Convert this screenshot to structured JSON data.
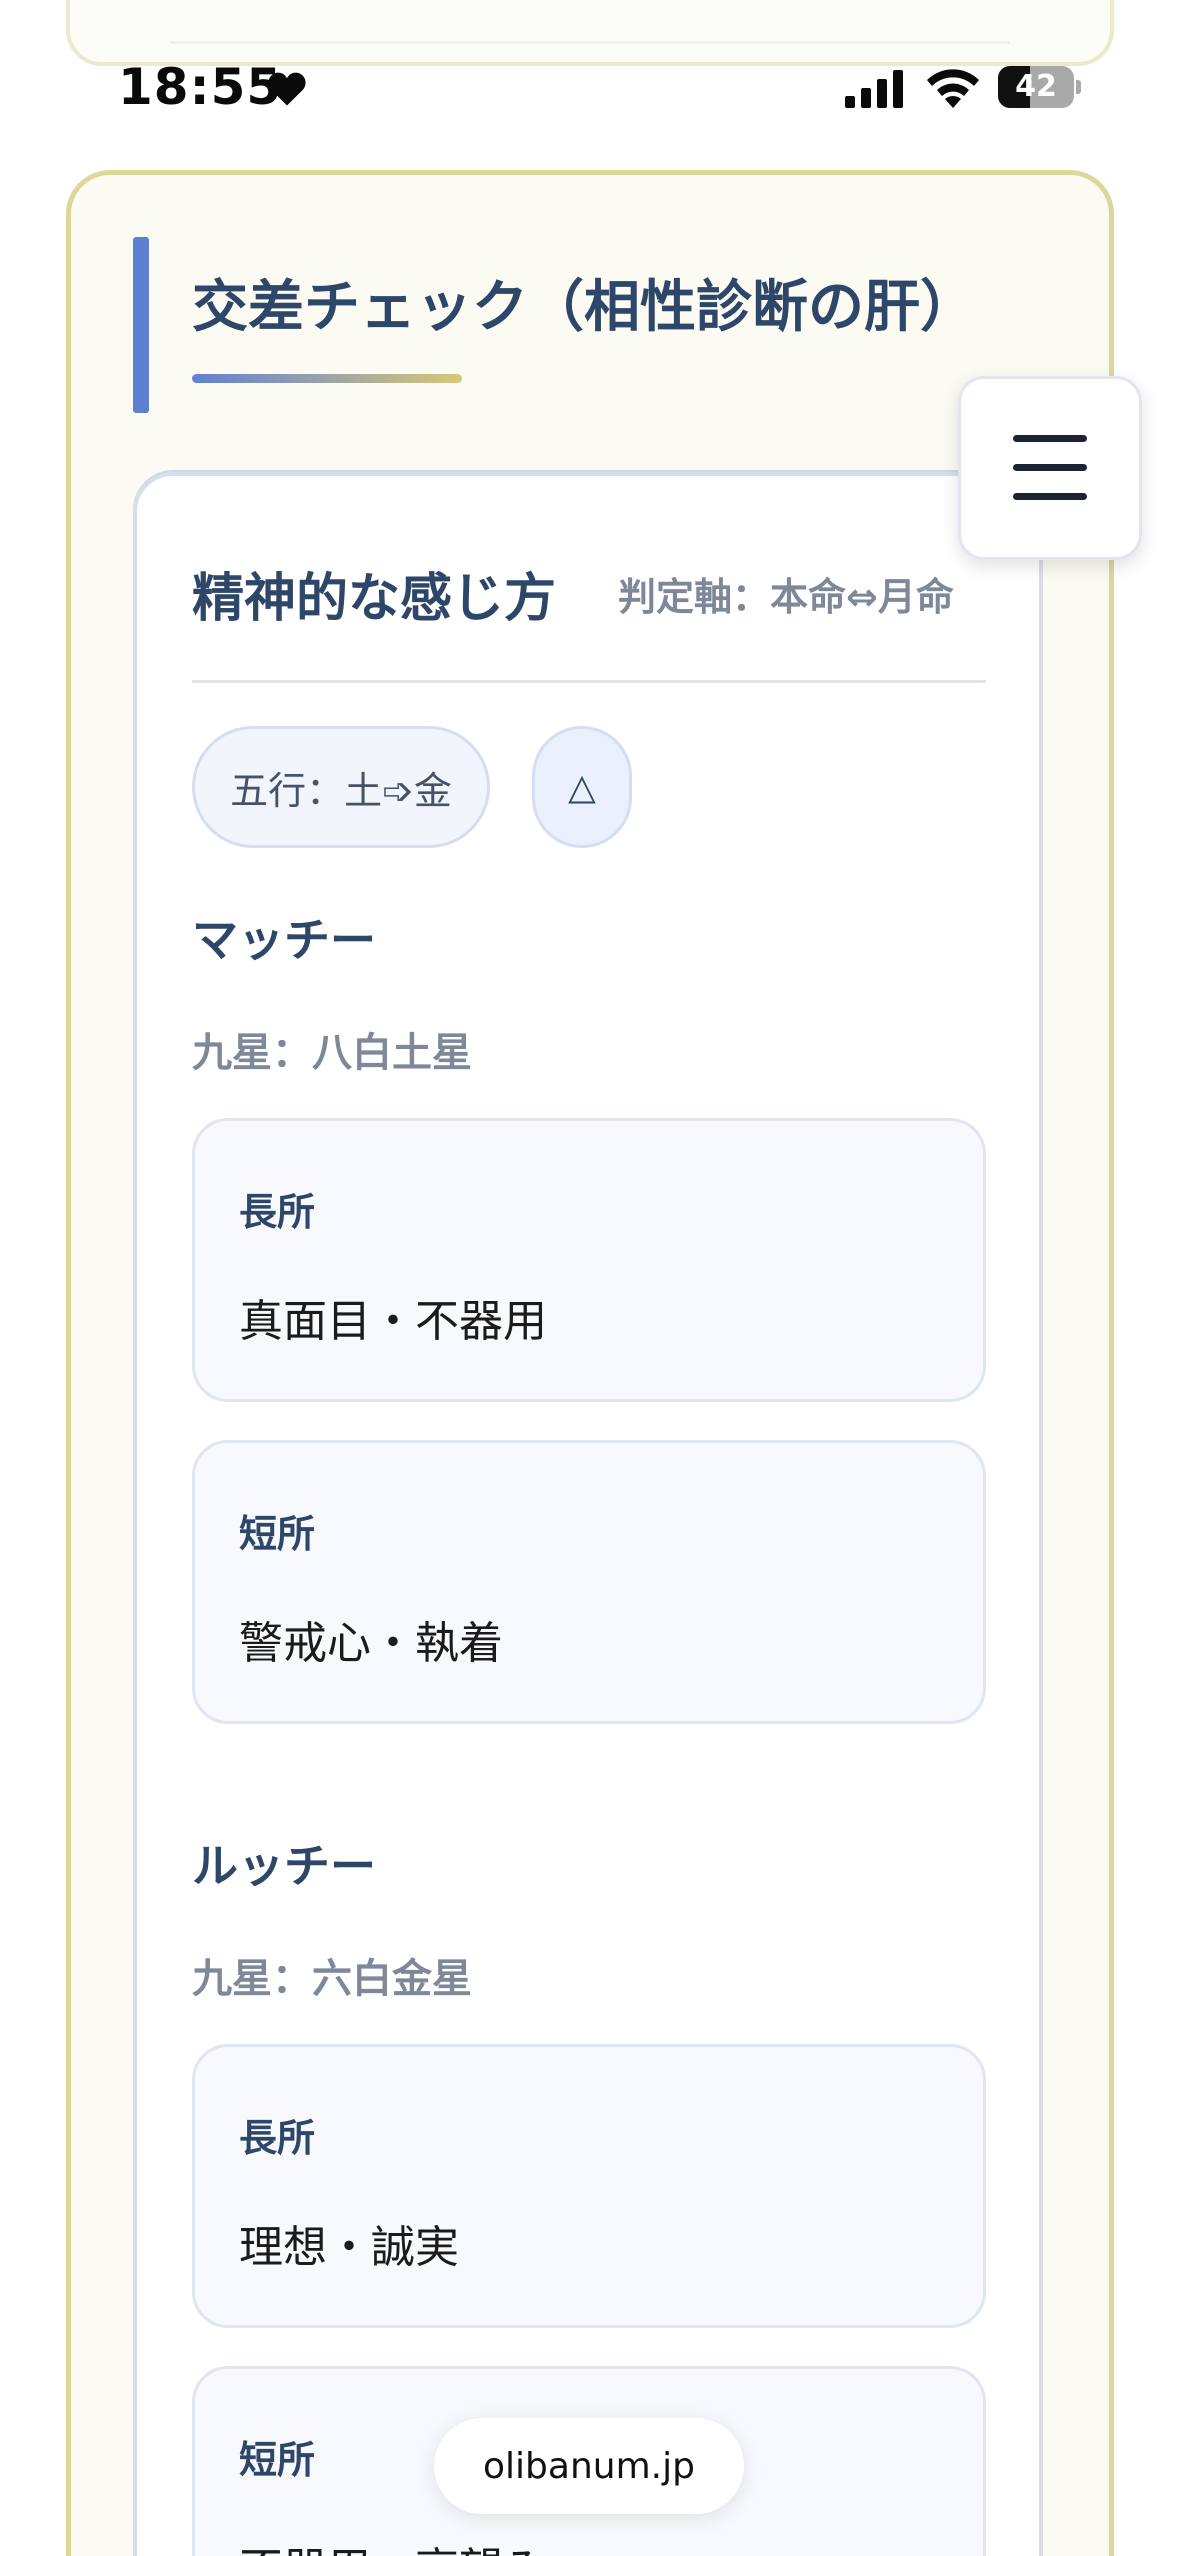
{
  "status_bar": {
    "time": "18:55",
    "battery_level": "42",
    "icons": [
      "heart-icon",
      "signal-icon",
      "wifi-icon",
      "battery-icon"
    ]
  },
  "section": {
    "title": "交差チェック（相性診断の肝）"
  },
  "card": {
    "heading": "精神的な感じ方",
    "judge_axis": "判定軸：本命⇔月命",
    "gogyo_badge": "五行：土➩金",
    "mark_badge": "△",
    "people": [
      {
        "name": "マッチー",
        "kyusei": "九星：八白土星",
        "strengths_label": "長所",
        "strengths": "真面目・不器用",
        "weaknesses_label": "短所",
        "weaknesses": "警戒心・執着"
      },
      {
        "name": "ルッチー",
        "kyusei": "九星：六白金星",
        "strengths_label": "長所",
        "strengths": "理想・誠実",
        "weaknesses_label": "短所",
        "weaknesses": "不器用・高望み"
      }
    ]
  },
  "menu": {
    "icon": "hamburger-menu-icon"
  },
  "browser": {
    "url": "olibanum.jp"
  },
  "colors": {
    "accent_blue": "#5c7fd1",
    "heading_navy": "#2e4668",
    "section_border": "#ded79a",
    "muted_text": "#7e8898"
  }
}
